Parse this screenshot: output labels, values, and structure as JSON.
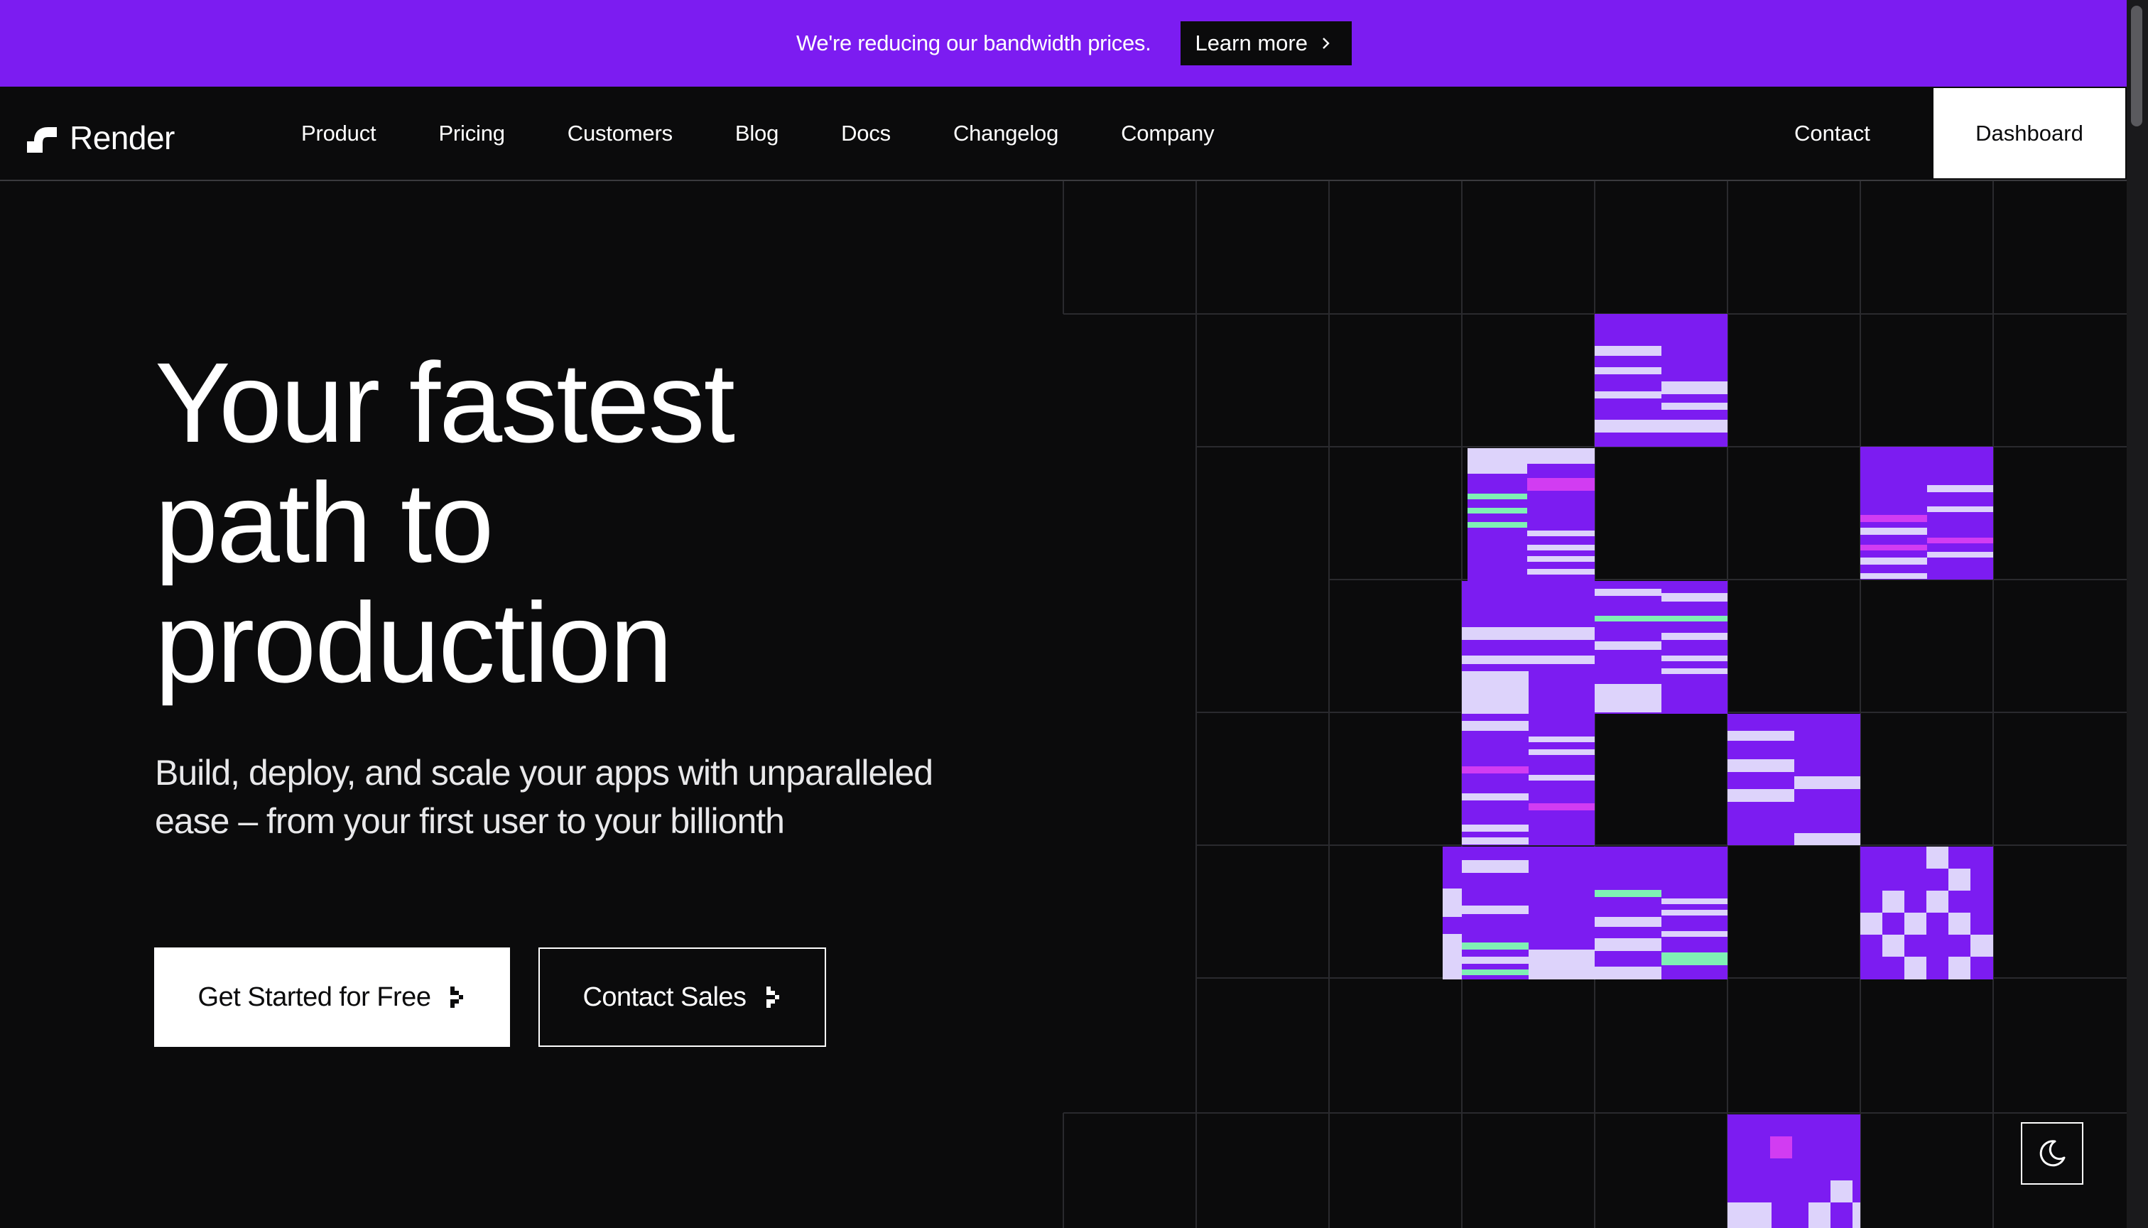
{
  "banner": {
    "text": "We're reducing our bandwidth prices.",
    "link_label": "Learn more"
  },
  "nav": {
    "logo_text": "Render",
    "links": [
      "Product",
      "Pricing",
      "Customers",
      "Blog",
      "Docs",
      "Changelog",
      "Company"
    ],
    "contact_label": "Contact",
    "dashboard_label": "Dashboard"
  },
  "hero": {
    "title_lines": [
      "Your fastest",
      "path to",
      "production"
    ],
    "subtitle_lines": [
      "Build, deploy, and scale your apps with unparalleled",
      "ease – from your first user to your billionth"
    ],
    "primary_cta": "Get Started for Free",
    "secondary_cta": "Contact Sales"
  },
  "colors": {
    "brand_purple": "#7c1cf1",
    "lavender": "#ddd3fb",
    "mint": "#7ff0b4",
    "magenta": "#d23cf2",
    "background": "#0b0b0c"
  },
  "icons": {
    "banner_link": "chevron-right-icon",
    "cta": "pixel-chevron-icon",
    "theme": "moon-icon",
    "logo": "render-logo"
  }
}
